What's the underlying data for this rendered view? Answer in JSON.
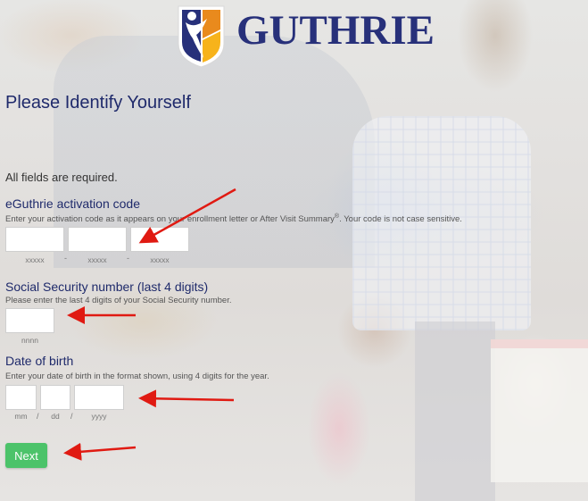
{
  "brand": {
    "name": "GUTHRIE",
    "logo_icon": "guthrie-shield-logo",
    "colors": {
      "navy": "#27307a",
      "orange": "#e98a1d",
      "yellow": "#f7b31b",
      "primary_button": "#4cc36a"
    }
  },
  "page": {
    "title": "Please Identify Yourself",
    "required_note": "All fields are required."
  },
  "activation_code": {
    "label": "eGuthrie activation code",
    "help_before": "Enter your activation code as it appears on your enrollment letter or After Visit Summary",
    "help_sup": "®",
    "help_after": ". Your code is not case sensitive.",
    "fields": [
      {
        "value": "",
        "hint": "xxxxx"
      },
      {
        "value": "",
        "hint": "xxxxx"
      },
      {
        "value": "",
        "hint": "xxxxx"
      }
    ],
    "separator": "-"
  },
  "ssn": {
    "label": "Social Security number (last 4 digits)",
    "help": "Please enter the last 4 digits of your Social Security number.",
    "value": "",
    "hint": "nnnn"
  },
  "dob": {
    "label": "Date of birth",
    "help": "Enter your date of birth in the format shown, using 4 digits for the year.",
    "fields": [
      {
        "value": "",
        "hint": "mm"
      },
      {
        "value": "",
        "hint": "dd"
      },
      {
        "value": "",
        "hint": "yyyy"
      }
    ],
    "separator": "/"
  },
  "actions": {
    "next_label": "Next"
  },
  "annotations": {
    "arrow_color": "#e01a12",
    "arrow_count": 4
  }
}
